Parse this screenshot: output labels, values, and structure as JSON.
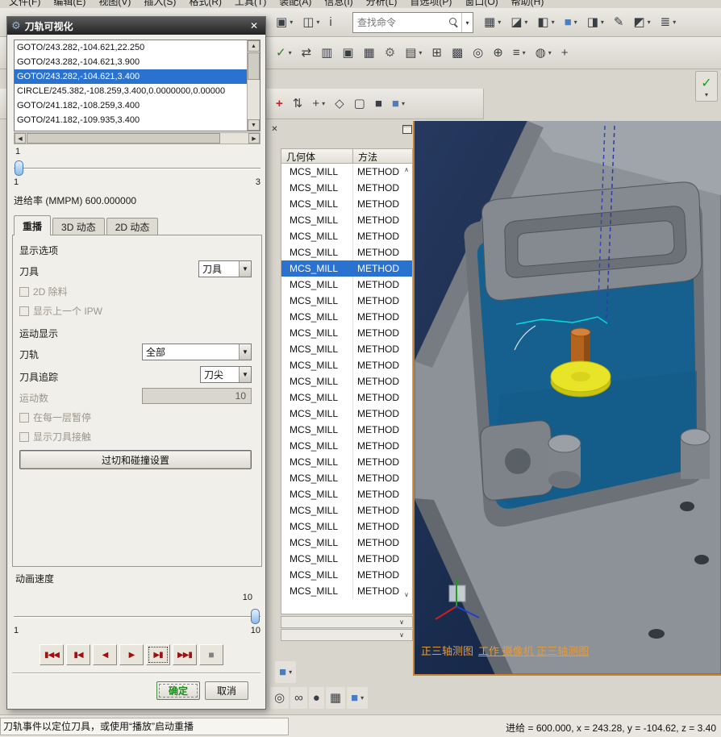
{
  "menubar": {
    "items": [
      "文件(F)",
      "编辑(E)",
      "视图(V)",
      "插入(S)",
      "格式(R)",
      "工具(T)",
      "装配(A)",
      "信息(I)",
      "分析(L)",
      "首选项(P)",
      "窗口(O)",
      "帮助(H)"
    ]
  },
  "toolbar_top": {
    "left_icons": [
      {
        "name": "new-file-icon",
        "glyph": "▤",
        "dropdown": false
      },
      {
        "name": "open-file-icon",
        "glyph": "▥",
        "dropdown": false
      },
      {
        "name": "save-icon",
        "glyph": "▦",
        "dropdown": true
      }
    ],
    "mid_icons": [
      {
        "name": "snapshot-icon",
        "glyph": "▣",
        "dropdown": true
      },
      {
        "name": "copy-display-icon",
        "glyph": "◫",
        "dropdown": true
      },
      {
        "name": "information-icon",
        "glyph": "i",
        "dropdown": false
      }
    ],
    "search": {
      "placeholder": "查找命令"
    },
    "right_icons": [
      {
        "name": "window-layout-icon",
        "glyph": "▦",
        "dropdown": true
      },
      {
        "name": "export-display-icon",
        "glyph": "◪",
        "dropdown": true
      },
      {
        "name": "shaded-view-icon",
        "glyph": "◧",
        "dropdown": true
      },
      {
        "name": "assembly-cube-icon",
        "glyph": "■",
        "dropdown": true
      },
      {
        "name": "orient-view-icon",
        "glyph": "◨",
        "dropdown": true
      },
      {
        "name": "edit-object-display-icon",
        "glyph": "✎",
        "dropdown": false
      },
      {
        "name": "show-hide-icon",
        "glyph": "◩",
        "dropdown": true
      },
      {
        "name": "layer-settings-icon",
        "glyph": "≣",
        "dropdown": true
      }
    ]
  },
  "toolbar_ops": {
    "icons": [
      {
        "name": "generate-toolpath-icon",
        "glyph": "✓",
        "dropdown": true
      },
      {
        "name": "verify-toolpath-icon",
        "glyph": "⇄",
        "dropdown": false
      },
      {
        "name": "simulate-icon",
        "glyph": "▥",
        "dropdown": false
      },
      {
        "name": "machine-cube-icon",
        "glyph": "▣",
        "dropdown": false
      },
      {
        "name": "list-output-icon",
        "glyph": "▦",
        "dropdown": false
      },
      {
        "name": "post-process-icon",
        "glyph": "⚙",
        "dropdown": false
      },
      {
        "name": "shop-doc-icon",
        "glyph": "▤",
        "dropdown": true
      },
      {
        "name": "measure-icon",
        "glyph": "⊞",
        "dropdown": false
      },
      {
        "name": "grid-icon",
        "glyph": "▩",
        "dropdown": false
      },
      {
        "name": "target-icon",
        "glyph": "◎",
        "dropdown": false
      },
      {
        "name": "crosshair-icon",
        "glyph": "⊕",
        "dropdown": false
      },
      {
        "name": "layers-icon",
        "glyph": "≡",
        "dropdown": true
      },
      {
        "name": "display-mode-icon",
        "glyph": "◍",
        "dropdown": true
      },
      {
        "name": "pan-icon",
        "glyph": "+",
        "dropdown": false
      }
    ],
    "apply_check": {
      "name": "apply-check-icon",
      "glyph": "✓"
    }
  },
  "toolbar_select": {
    "icons": [
      {
        "name": "add-point-icon",
        "glyph": "+",
        "dropdown": false
      },
      {
        "name": "swap-arrows-icon",
        "glyph": "⇅",
        "dropdown": false
      },
      {
        "name": "move-handle-icon",
        "glyph": "+",
        "dropdown": true
      },
      {
        "name": "snap-point-icon",
        "glyph": "◇",
        "dropdown": false
      },
      {
        "name": "selection-box-icon",
        "glyph": "▢",
        "dropdown": false
      },
      {
        "name": "solid-cube-icon",
        "glyph": "■",
        "dropdown": false
      },
      {
        "name": "shaded-cube-icon",
        "glyph": "■",
        "dropdown": true
      }
    ]
  },
  "bottom_toolbar": {
    "row1": [
      {
        "name": "workpiece-cube-icon",
        "glyph": "■",
        "dropdown": true
      }
    ],
    "row2": [
      {
        "name": "spheres-icon",
        "glyph": "◎",
        "dropdown": false
      },
      {
        "name": "link-icon",
        "glyph": "∞",
        "dropdown": false
      },
      {
        "name": "ball-icon",
        "glyph": "●",
        "dropdown": false
      },
      {
        "name": "mesh-icon",
        "glyph": "▦",
        "dropdown": false
      },
      {
        "name": "display-cube-icon",
        "glyph": "■",
        "dropdown": true
      }
    ]
  },
  "dialog": {
    "title": "刀轨可视化",
    "list_items": [
      {
        "text": "GOTO/243.282,-104.621,22.250",
        "selected": false
      },
      {
        "text": "GOTO/243.282,-104.621,3.900",
        "selected": false
      },
      {
        "text": "GOTO/243.282,-104.621,3.400",
        "selected": true
      },
      {
        "text": "CIRCLE/245.382,-108.259,3.400,0.0000000,0.00000",
        "selected": false
      },
      {
        "text": "GOTO/241.182,-108.259,3.400",
        "selected": false
      },
      {
        "text": "GOTO/241.182,-109.935,3.400",
        "selected": false
      }
    ],
    "frame": {
      "value": "1",
      "min": "1",
      "max": "3"
    },
    "feed_label": "进给率 (MMPM) 600.000000",
    "tabs": [
      {
        "label": "重播",
        "active": true
      },
      {
        "label": "3D 动态",
        "active": false
      },
      {
        "label": "2D 动态",
        "active": false
      }
    ],
    "display_options_label": "显示选项",
    "tool_label": "刀具",
    "tool_value": "刀具",
    "cb_2d_label": "2D 除料",
    "cb_ipw_label": "显示上一个 IPW",
    "motion_display_label": "运动显示",
    "path_label": "刀轨",
    "path_value": "全部",
    "track_label": "刀具追踪",
    "track_value": "刀尖",
    "count_label": "运动数",
    "count_value": "10",
    "cb_pause_label": "在每一层暂停",
    "cb_contact_label": "显示刀具接触",
    "gouge_button_label": "过切和碰撞设置",
    "speed_label": "动画速度",
    "speed": {
      "value": "10",
      "min": "1",
      "max": "10"
    },
    "transport": [
      {
        "name": "go-to-start-button",
        "glyph": "▮◀◀"
      },
      {
        "name": "step-backward-button",
        "glyph": "▮◀"
      },
      {
        "name": "play-backward-button",
        "glyph": "◀"
      },
      {
        "name": "play-forward-button",
        "glyph": "▶"
      },
      {
        "name": "step-forward-button",
        "glyph": "▶▮",
        "focused": true
      },
      {
        "name": "go-to-end-button",
        "glyph": "▶▶▮"
      },
      {
        "name": "stop-button",
        "glyph": "■",
        "gray": true
      }
    ],
    "ok_label": "确定",
    "cancel_label": "取消"
  },
  "navigator": {
    "columns": {
      "geometry": "几何体",
      "method": "方法"
    },
    "rows": [
      {
        "geometry": "MCS_MILL",
        "method": "METHOD"
      },
      {
        "geometry": "MCS_MILL",
        "method": "METHOD"
      },
      {
        "geometry": "MCS_MILL",
        "method": "METHOD"
      },
      {
        "geometry": "MCS_MILL",
        "method": "METHOD"
      },
      {
        "geometry": "MCS_MILL",
        "method": "METHOD"
      },
      {
        "geometry": "MCS_MILL",
        "method": "METHOD"
      },
      {
        "geometry": "MCS_MILL",
        "method": "METHOD",
        "selected": true
      },
      {
        "geometry": "MCS_MILL",
        "method": "METHOD"
      },
      {
        "geometry": "MCS_MILL",
        "method": "METHOD"
      },
      {
        "geometry": "MCS_MILL",
        "method": "METHOD"
      },
      {
        "geometry": "MCS_MILL",
        "method": "METHOD"
      },
      {
        "geometry": "MCS_MILL",
        "method": "METHOD"
      },
      {
        "geometry": "MCS_MILL",
        "method": "METHOD"
      },
      {
        "geometry": "MCS_MILL",
        "method": "METHOD"
      },
      {
        "geometry": "MCS_MILL",
        "method": "METHOD"
      },
      {
        "geometry": "MCS_MILL",
        "method": "METHOD"
      },
      {
        "geometry": "MCS_MILL",
        "method": "METHOD"
      },
      {
        "geometry": "MCS_MILL",
        "method": "METHOD"
      },
      {
        "geometry": "MCS_MILL",
        "method": "METHOD"
      },
      {
        "geometry": "MCS_MILL",
        "method": "METHOD"
      },
      {
        "geometry": "MCS_MILL",
        "method": "METHOD"
      },
      {
        "geometry": "MCS_MILL",
        "method": "METHOD"
      },
      {
        "geometry": "MCS_MILL",
        "method": "METHOD"
      },
      {
        "geometry": "MCS_MILL",
        "method": "METHOD"
      },
      {
        "geometry": "MCS_MILL",
        "method": "METHOD"
      },
      {
        "geometry": "MCS_MILL",
        "method": "METHOD"
      },
      {
        "geometry": "MCS_MILL",
        "method": "METHOD"
      }
    ]
  },
  "viewport": {
    "view_label_plain": "正三轴测图",
    "view_label_links": "工作 摄像机 正三轴测图"
  },
  "statusbar": {
    "left": "刀轨事件以定位刀具，或使用“播放”启动重播",
    "right": "进给 = 600.000, x = 243.28, y = -104.62, z = 3.40"
  }
}
